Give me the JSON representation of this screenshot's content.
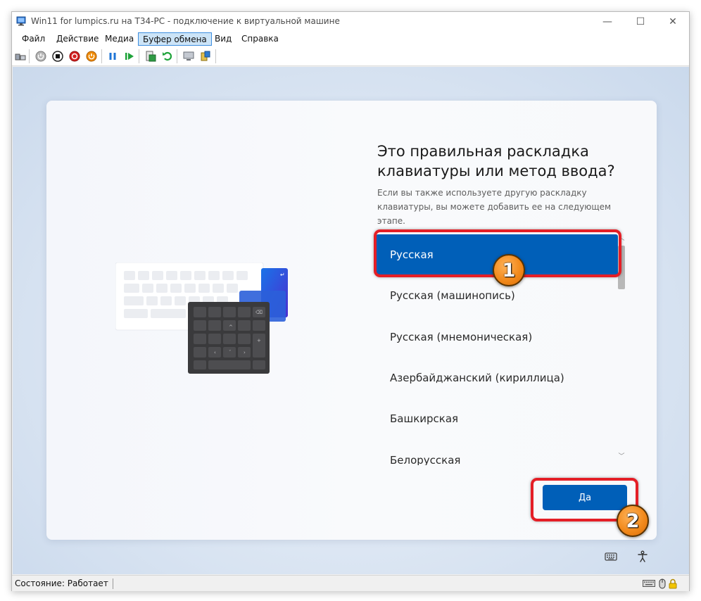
{
  "window": {
    "title": "Win11 for lumpics.ru на Т34-PC - подключение к виртуальной машине",
    "controls": {
      "minimize": "—",
      "maximize": "☐",
      "close": "✕"
    }
  },
  "menubar": {
    "items": [
      "Файл",
      "Действие",
      "Медиа",
      "Буфер обмена",
      "Вид",
      "Справка"
    ],
    "active_index": 3
  },
  "toolbar": {
    "buttons": [
      "ctrl-alt-del-icon",
      "start-icon",
      "turn-off-icon",
      "shut-down-icon",
      "save-icon",
      "pause-icon",
      "reset-icon",
      "checkpoint-icon",
      "revert-icon",
      "enhanced-session-icon",
      "share-icon"
    ]
  },
  "oobe": {
    "heading": "Это правильная раскладка клавиатуры или метод ввода?",
    "subtext": "Если вы также используете другую раскладку клавиатуры, вы можете добавить ее на следующем этапе.",
    "layouts": [
      "Русская",
      "Русская (машинопись)",
      "Русская (мнемоническая)",
      "Азербайджанский (кириллица)",
      "Башкирская",
      "Белорусская"
    ],
    "selected_index": 0,
    "yes_button": "Да"
  },
  "annotations": {
    "badge_1": "1",
    "badge_2": "2",
    "accent_color": "#e41e26",
    "badge_color": "#f28a1c"
  },
  "statusbar": {
    "state": "Состояние: Работает"
  },
  "colors": {
    "selected_bg": "#005fb8",
    "button_bg": "#005fb8"
  }
}
